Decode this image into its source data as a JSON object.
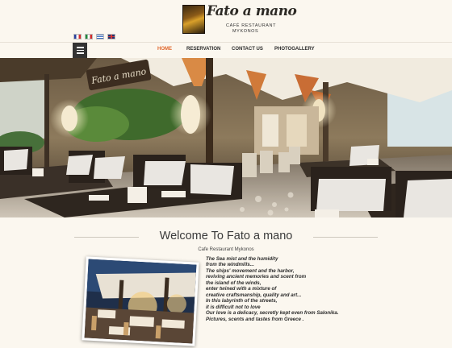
{
  "brand": {
    "name": "Fato a mano",
    "subtitle": "CAFÉ RESTAURANT",
    "location": "MYKONOS"
  },
  "languages": [
    {
      "code": "fr",
      "icon": "france-flag-icon"
    },
    {
      "code": "it",
      "icon": "italy-flag-icon"
    },
    {
      "code": "gr",
      "icon": "greece-flag-icon"
    },
    {
      "code": "en",
      "icon": "uk-flag-icon"
    }
  ],
  "nav": {
    "menu_icon": "hamburger-menu-icon",
    "items": [
      "HOME",
      "RESERVATION",
      "CONTACT US",
      "PHOTOGALLERY"
    ],
    "active": "HOME",
    "active_color": "#e0672c"
  },
  "hero": {
    "sign_text": "Fato a mano"
  },
  "welcome": {
    "title": "Welcome To Fato a mano",
    "subtitle": "Cafe Restaurant Mykonos",
    "poem": [
      "The Sea mist and the humidity",
      "from the windmills...",
      "The ships' movement and the harbor,",
      "reviving ancient memories and scent from",
      "the island of the winds,",
      "enter twined with a mixture of",
      "creative craftsmanship, quality and art...",
      "In this labyrinth of the streets,",
      "it is difficult not to love",
      "Our love is a delicacy, secretly kept even from Salonika.",
      "Pictures, scents and tastes from Greece ."
    ]
  }
}
